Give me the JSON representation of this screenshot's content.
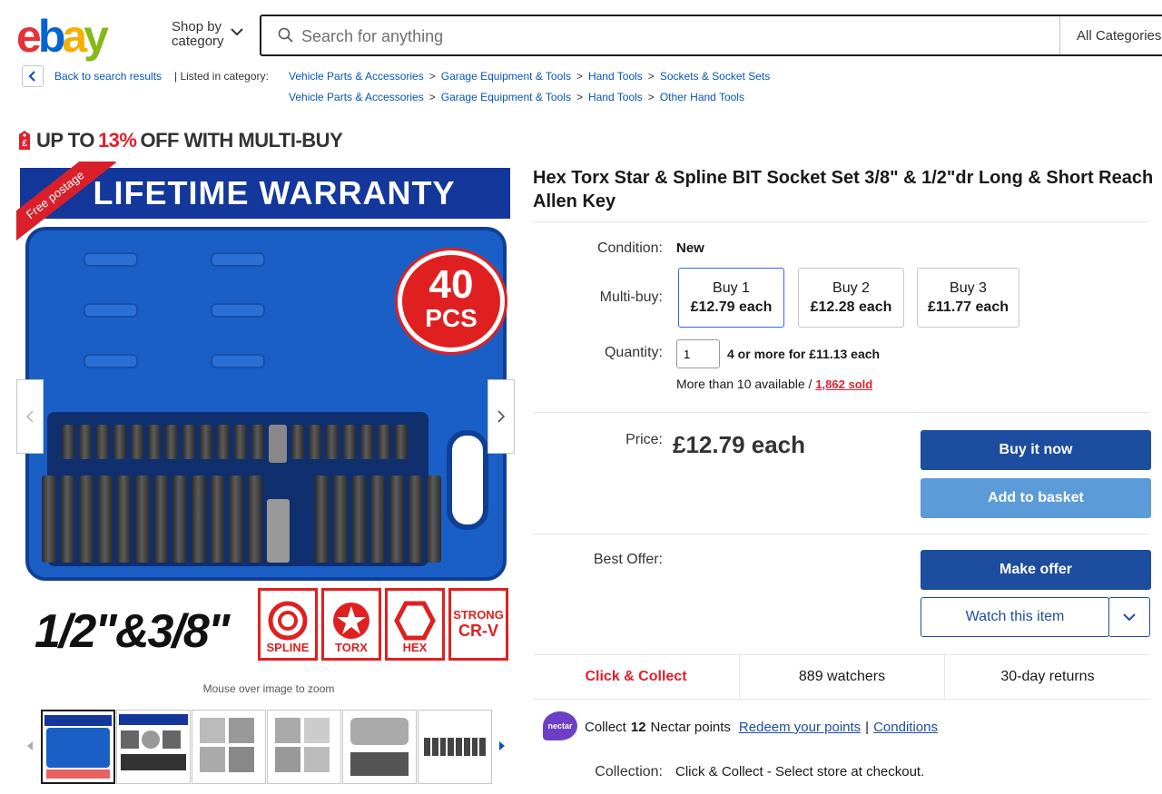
{
  "header": {
    "logo_letters": [
      "e",
      "b",
      "a",
      "y"
    ],
    "logo_colors": [
      "#e53238",
      "#0064d2",
      "#f5af02",
      "#86b817"
    ],
    "shop_by_line1": "Shop by",
    "shop_by_line2": "category",
    "search_placeholder": "Search for anything",
    "category_select": "All Categories"
  },
  "breadcrumbs": {
    "back_label": "Back to search results",
    "listed_in": "| Listed in category:",
    "row1": [
      "Vehicle Parts & Accessories",
      "Garage Equipment & Tools",
      "Hand Tools",
      "Sockets & Socket Sets"
    ],
    "row2": [
      "Vehicle Parts & Accessories",
      "Garage Equipment & Tools",
      "Hand Tools",
      "Other Hand Tools"
    ],
    "separator": ">"
  },
  "promo": {
    "prefix": "UP TO",
    "percent": "13%",
    "suffix": "OFF WITH MULTI-BUY"
  },
  "image": {
    "banner": "LIFETIME WARRANTY",
    "free_postage": "Free postage",
    "badge_number": "40",
    "badge_unit": "PCS",
    "sizes": "1/2\"&3/8\"",
    "features": [
      "SPLINE",
      "TORX",
      "HEX"
    ],
    "strong_line1": "STRONG",
    "strong_line2": "CR-V",
    "zoom_hint": "Mouse over image to zoom"
  },
  "product": {
    "title": "Hex Torx Star & Spline BIT Socket Set 3/8\" & 1/2\"dr Long & Short Reach Allen Key",
    "condition_label": "Condition:",
    "condition_value": "New",
    "multibuy_label": "Multi-buy:",
    "multibuy": [
      {
        "qty": "Buy 1",
        "price": "£12.79 each"
      },
      {
        "qty": "Buy 2",
        "price": "£12.28 each"
      },
      {
        "qty": "Buy 3",
        "price": "£11.77 each"
      }
    ],
    "quantity_label": "Quantity:",
    "quantity_value": "1",
    "bulk_offer": "4 or more for £11.13 each",
    "availability": "More than 10 available /",
    "sold": "1,862 sold",
    "price_label": "Price:",
    "price_value": "£12.79 each",
    "buy_now": "Buy it now",
    "add_to_basket": "Add to basket",
    "best_offer_label": "Best Offer:",
    "make_offer": "Make offer",
    "watch": "Watch this item",
    "click_collect": "Click & Collect",
    "watchers": "889 watchers",
    "returns": "30-day returns",
    "nectar_logo": "nectar",
    "nectar_prefix": "Collect",
    "nectar_points": "12",
    "nectar_suffix": "Nectar points",
    "redeem": "Redeem your points",
    "nectar_sep": "|",
    "conditions": "Conditions",
    "collection_label": "Collection:",
    "collection_value": "Click & Collect - Select store at checkout."
  },
  "colors": {
    "primary_button": "#1c4d9f",
    "secondary_button": "#5b9bd8",
    "promo_red": "#e0202e",
    "link_blue": "#0654ba"
  }
}
